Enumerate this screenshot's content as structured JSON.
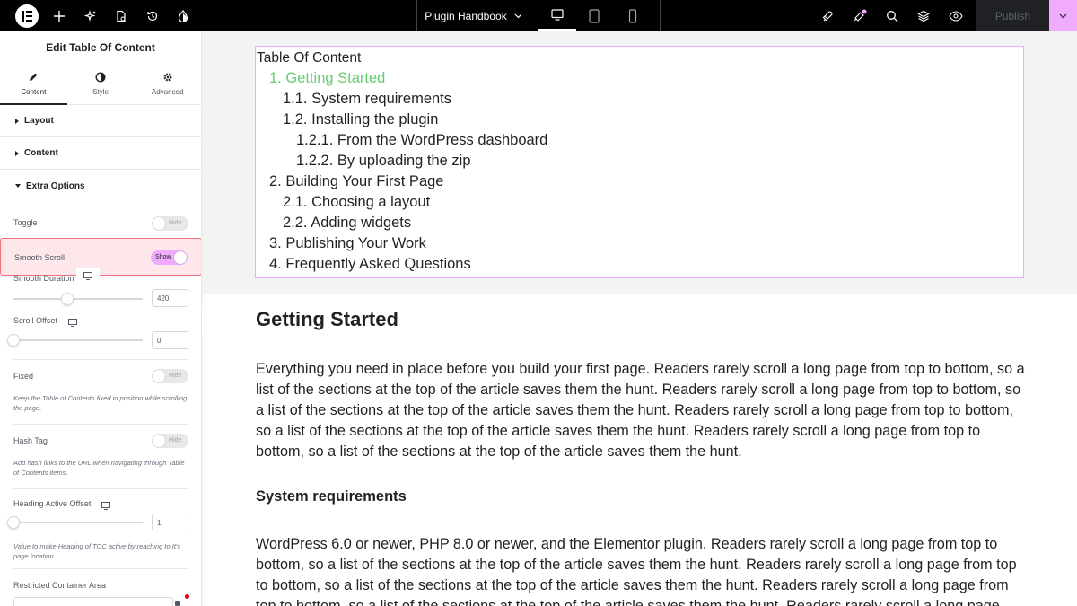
{
  "topbar": {
    "document_title": "Plugin Handbook",
    "publish_label": "Publish",
    "accent_color": "#f0abfc"
  },
  "panel": {
    "title": "Edit Table Of Content",
    "tabs": [
      {
        "label": "Content",
        "icon": "pencil-icon"
      },
      {
        "label": "Style",
        "icon": "half-circle-icon"
      },
      {
        "label": "Advanced",
        "icon": "gear-icon"
      }
    ],
    "sections": {
      "layout": "Layout",
      "content": "Content",
      "extra_options": "Extra Options"
    },
    "toggle": {
      "label": "Toggle",
      "state": "Hide"
    },
    "smooth_scroll": {
      "label": "Smooth Scroll",
      "state": "Show"
    },
    "smooth_duration": {
      "label": "Smooth Duration",
      "value": "420"
    },
    "scroll_offset": {
      "label": "Scroll Offset",
      "value": "0"
    },
    "fixed": {
      "label": "Fixed",
      "state": "Hide",
      "hint": "Keep the Table of Contents fixed in position while scrolling the page."
    },
    "hash_tag": {
      "label": "Hash Tag",
      "state": "Hide",
      "hint": "Add hash links to the URL when navigating through Table of Contents items."
    },
    "heading_active_offset": {
      "label": "Heading Active Offset",
      "value": "1",
      "hint": "Value to make Heading of TOC active by reaching to It's page location."
    },
    "restricted_area": {
      "label": "Restricted Container Area"
    }
  },
  "toc": {
    "title": "Table Of Content",
    "items": [
      {
        "num": "1.",
        "text": "Getting Started"
      },
      {
        "num": "1.1.",
        "text": "System requirements"
      },
      {
        "num": "1.2.",
        "text": "Installing the plugin"
      },
      {
        "num": "1.2.1.",
        "text": "From the WordPress dashboard"
      },
      {
        "num": "1.2.2.",
        "text": "By uploading the zip"
      },
      {
        "num": "2.",
        "text": "Building Your First Page"
      },
      {
        "num": "2.1.",
        "text": "Choosing a layout"
      },
      {
        "num": "2.2.",
        "text": "Adding widgets"
      },
      {
        "num": "3.",
        "text": "Publishing Your Work"
      },
      {
        "num": "4.",
        "text": "Frequently Asked Questions"
      }
    ],
    "active_color": "#61ce70"
  },
  "article": {
    "h2": "Getting Started",
    "p1": "Everything you need in place before you build your first page. Readers rarely scroll a long page from top to bottom, so a list of the sections at the top of the article saves them the hunt. Readers rarely scroll a long page from top to bottom, so a list of the sections at the top of the article saves them the hunt. Readers rarely scroll a long page from top to bottom, so a list of the sections at the top of the article saves them the hunt. Readers rarely scroll a long page from top to bottom, so a list of the sections at the top of the article saves them the hunt.",
    "h3": "System requirements",
    "p2": "WordPress 6.0 or newer, PHP 8.0 or newer, and the Elementor plugin. Readers rarely scroll a long page from top to bottom, so a list of the sections at the top of the article saves them the hunt. Readers rarely scroll a long page from top to bottom, so a list of the sections at the top of the article saves them the hunt. Readers rarely scroll a long page from top to bottom, so a list of the sections at the top of the article saves them the hunt. Readers rarely scroll a long page"
  }
}
